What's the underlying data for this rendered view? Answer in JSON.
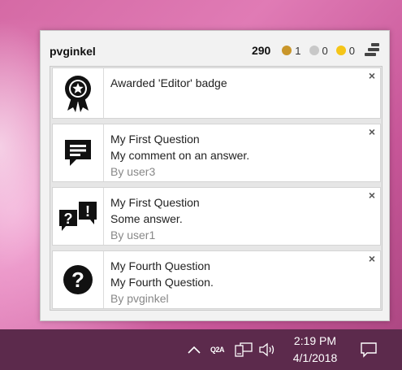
{
  "header": {
    "username": "pvginkel",
    "reputation": "290",
    "badges": [
      {
        "kind": "gold",
        "color": "#c9962a",
        "count": "1"
      },
      {
        "kind": "silver",
        "color": "#c8c8c8",
        "count": "0"
      },
      {
        "kind": "bronze-yellow",
        "color": "#f5c518",
        "count": "0"
      }
    ],
    "menu_icon": "stack-overflow-stack-icon"
  },
  "notifications": [
    {
      "icon": "award-badge-icon",
      "lines": [
        "Awarded 'Editor' badge"
      ],
      "by": "",
      "close_label": "×"
    },
    {
      "icon": "comment-icon",
      "lines": [
        "My First Question",
        "My comment on an answer."
      ],
      "by": "By user3",
      "close_label": "×"
    },
    {
      "icon": "answer-icon",
      "lines": [
        "My First Question",
        "Some answer."
      ],
      "by": "By user1",
      "close_label": "×"
    },
    {
      "icon": "question-icon",
      "lines": [
        "My Fourth Question",
        "My Fourth Question."
      ],
      "by": "By pvginkel",
      "close_label": "×"
    }
  ],
  "taskbar": {
    "tray_app_label": "Q2A",
    "time": "2:19 PM",
    "date": "4/1/2018",
    "background": "#5c2a4c"
  }
}
